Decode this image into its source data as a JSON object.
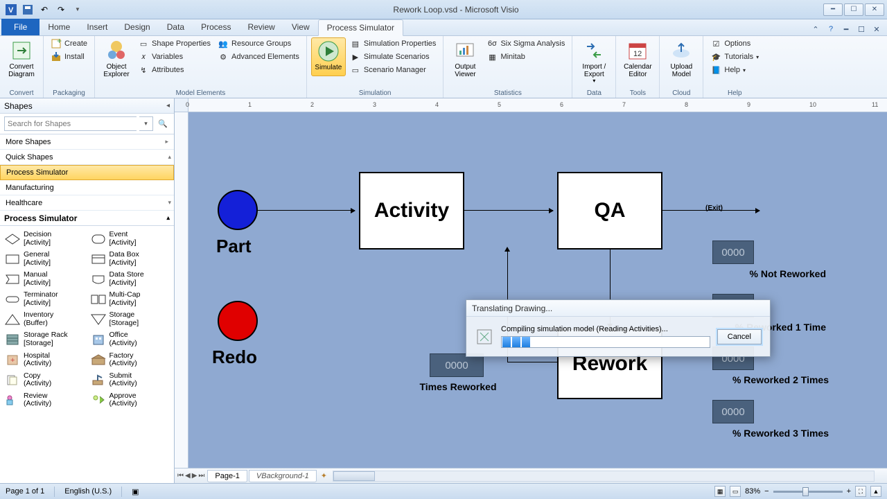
{
  "app": {
    "title": "Rework Loop.vsd - Microsoft Visio"
  },
  "tabs": {
    "file": "File",
    "home": "Home",
    "insert": "Insert",
    "design": "Design",
    "data": "Data",
    "process": "Process",
    "review": "Review",
    "view": "View",
    "psim": "Process Simulator"
  },
  "ribbon": {
    "convert": {
      "big": "Convert\nDiagram",
      "label": "Convert"
    },
    "packaging": {
      "create": "Create",
      "install": "Install",
      "label": "Packaging"
    },
    "modelElements": {
      "objectExplorer": "Object\nExplorer",
      "shapeProps": "Shape Properties",
      "variables": "Variables",
      "attributes": "Attributes",
      "resourceGroups": "Resource Groups",
      "advancedElements": "Advanced Elements",
      "label": "Model Elements"
    },
    "simulation": {
      "simulate": "Simulate",
      "simProps": "Simulation Properties",
      "simScenarios": "Simulate Scenarios",
      "scenarioMgr": "Scenario Manager",
      "label": "Simulation"
    },
    "statistics": {
      "outputViewer": "Output\nViewer",
      "sixSigma": "Six Sigma Analysis",
      "minitab": "Minitab",
      "label": "Statistics"
    },
    "data": {
      "importExport": "Import /\nExport",
      "label": "Data"
    },
    "tools": {
      "calendar": "Calendar\nEditor",
      "label": "Tools"
    },
    "cloud": {
      "upload": "Upload\nModel",
      "label": "Cloud"
    },
    "help": {
      "options": "Options",
      "tutorials": "Tutorials",
      "helpBtn": "Help",
      "label": "Help"
    }
  },
  "shapesPanel": {
    "title": "Shapes",
    "searchPlaceholder": "Search for Shapes",
    "more": "More Shapes",
    "quick": "Quick Shapes",
    "psim": "Process Simulator",
    "mfg": "Manufacturing",
    "health": "Healthcare",
    "section": "Process Simulator",
    "shapes": [
      [
        "Decision\n[Activity]",
        "Event\n[Activity]"
      ],
      [
        "General\n[Activity]",
        "Data Box\n[Activity]"
      ],
      [
        "Manual\n[Activity]",
        "Data Store\n[Activity]"
      ],
      [
        "Terminator\n[Activity]",
        "Multi-Cap\n[Activity]"
      ],
      [
        "Inventory\n(Buffer)",
        "Storage\n[Storage]"
      ],
      [
        "Storage Rack\n[Storage]",
        "Office\n(Activity)"
      ],
      [
        "Hospital\n(Activity)",
        "Factory\n(Activity)"
      ],
      [
        "Copy\n(Activity)",
        "Submit\n(Activity)"
      ],
      [
        "Review\n(Activity)",
        "Approve\n(Activity)"
      ]
    ]
  },
  "canvas": {
    "activity": "Activity",
    "qa": "QA",
    "rework": "Rework",
    "part": "Part",
    "redo": "Redo",
    "exit": "(Exit)",
    "timesReworked": "Times Reworked",
    "notReworked": "% Not Reworked",
    "r1": "% Reworked 1 Time",
    "r2": "% Reworked 2 Times",
    "r3": "% Reworked 3 Times",
    "dbValue": "0000"
  },
  "dialog": {
    "title": "Translating Drawing...",
    "msg": "Compiling simulation model (Reading Activities)...",
    "cancel": "Cancel"
  },
  "pageTabs": {
    "page1": "Page-1",
    "bg": "VBackground-1"
  },
  "status": {
    "page": "Page 1 of 1",
    "lang": "English (U.S.)",
    "zoom": "83%"
  },
  "ruler": {
    "ticks": [
      "0",
      "1",
      "2",
      "3",
      "4",
      "5",
      "6",
      "7",
      "8",
      "9",
      "10",
      "11"
    ]
  }
}
